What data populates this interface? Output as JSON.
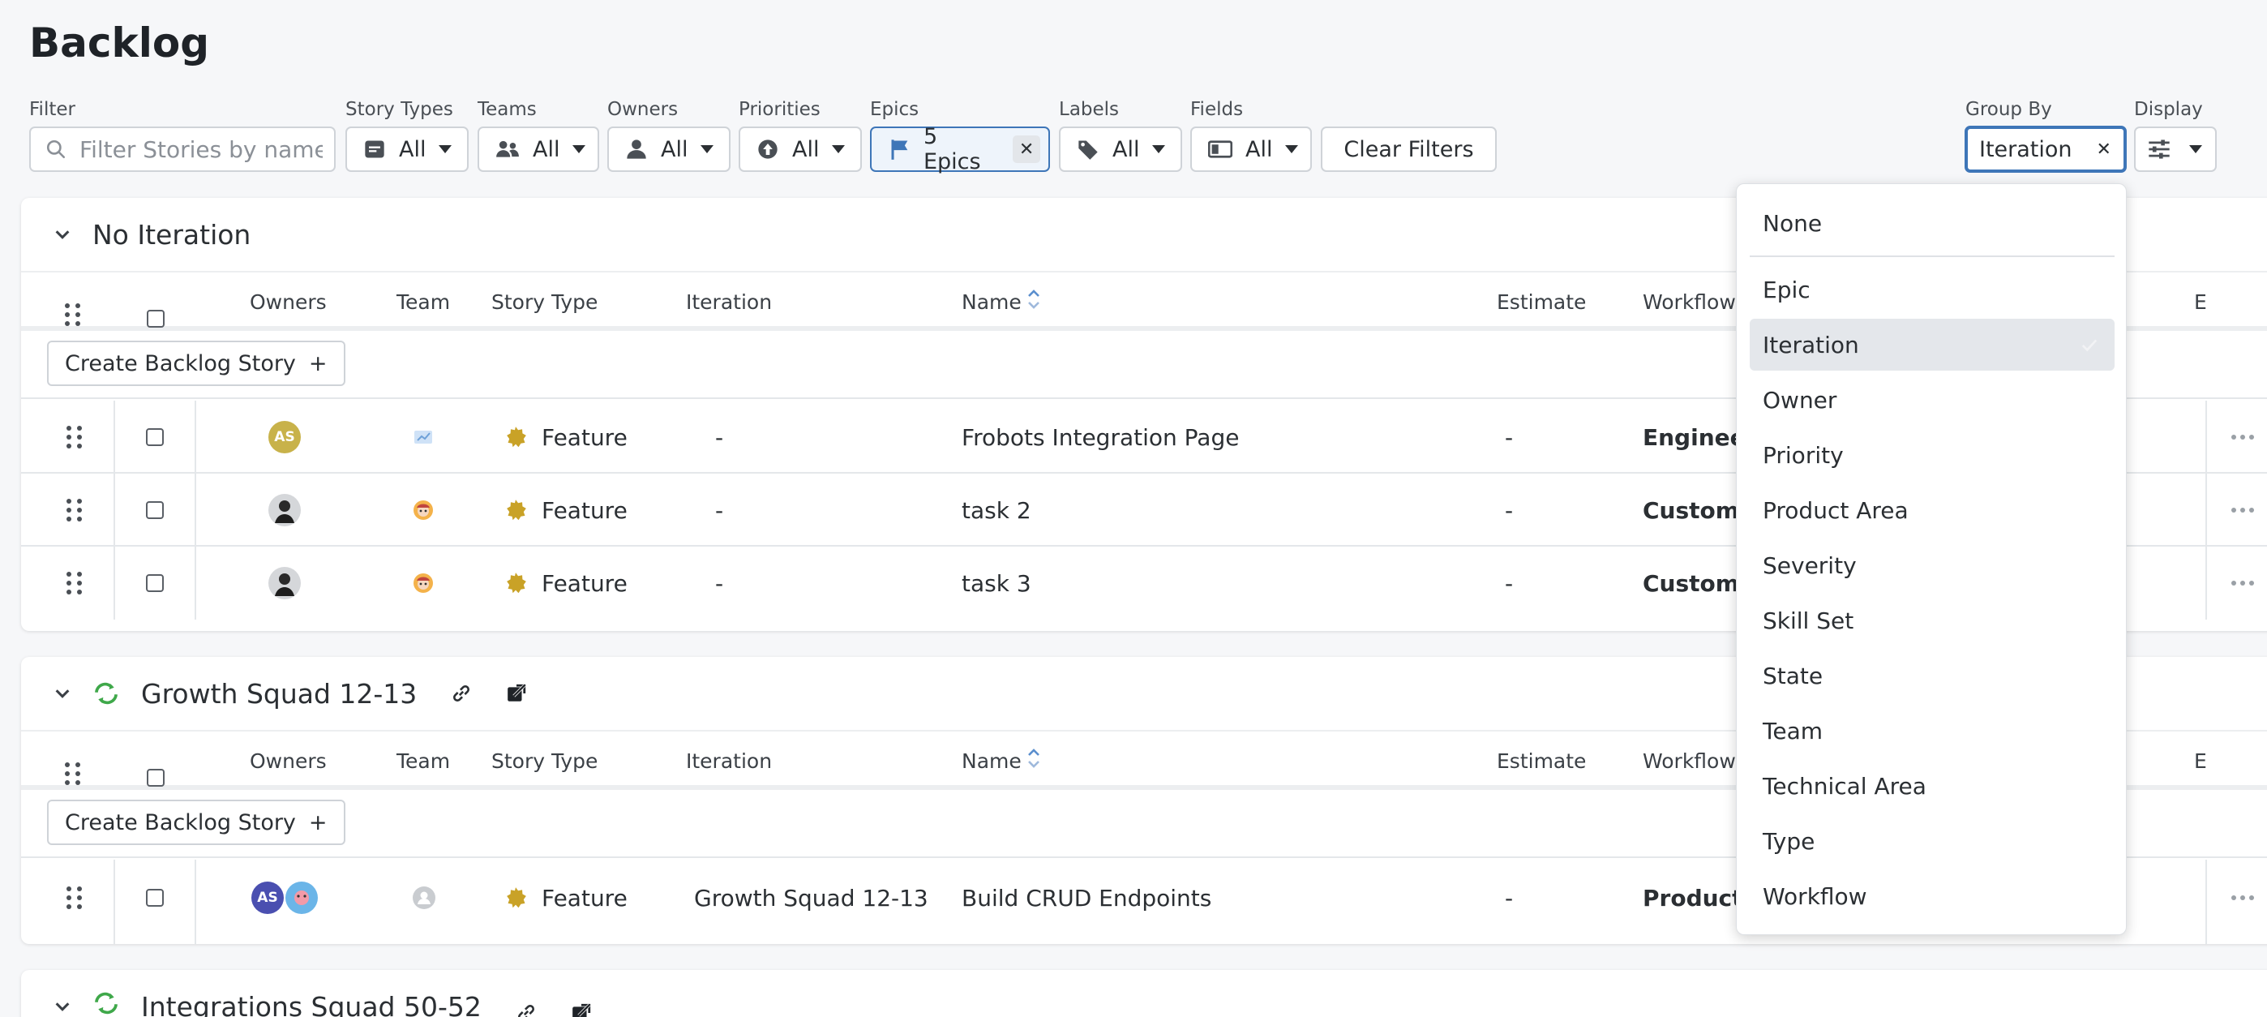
{
  "page_title": "Backlog",
  "filters": {
    "filter_label": "Filter",
    "search_placeholder": "Filter Stories by name",
    "story_types": {
      "label": "Story Types",
      "value": "All"
    },
    "teams": {
      "label": "Teams",
      "value": "All"
    },
    "owners": {
      "label": "Owners",
      "value": "All"
    },
    "priorities": {
      "label": "Priorities",
      "value": "All"
    },
    "epics": {
      "label": "Epics",
      "value": "5 Epics"
    },
    "labels": {
      "label": "Labels",
      "value": "All"
    },
    "fields": {
      "label": "Fields",
      "value": "All"
    },
    "clear_label": "Clear Filters",
    "group_by": {
      "label": "Group By",
      "value": "Iteration"
    },
    "display": {
      "label": "Display"
    }
  },
  "columns": {
    "owners": "Owners",
    "team": "Team",
    "story_type": "Story Type",
    "iteration": "Iteration",
    "name": "Name",
    "estimate": "Estimate",
    "workflow": "Workflow",
    "epic_short": "E"
  },
  "create_label": "Create Backlog Story",
  "groups": [
    {
      "title": "No Iteration",
      "rows": [
        {
          "owner_initials": "AS",
          "story_type": "Feature",
          "iteration": "-",
          "name": "Frobots Integration Page",
          "estimate": "-",
          "workflow": "Engineeri"
        },
        {
          "story_type": "Feature",
          "iteration": "-",
          "name": "task 2",
          "estimate": "-",
          "workflow": "Customer"
        },
        {
          "story_type": "Feature",
          "iteration": "-",
          "name": "task 3",
          "estimate": "-",
          "workflow": "Customer"
        }
      ]
    },
    {
      "title": "Growth Squad 12-13",
      "rows": [
        {
          "owner_initials": "AS",
          "story_type": "Feature",
          "iteration": "Growth Squad 12-13",
          "name": "Build CRUD Endpoints",
          "estimate": "-",
          "workflow": "Product"
        }
      ]
    },
    {
      "title": "Integrations Squad 50-52"
    }
  ],
  "group_by_menu": {
    "selected": "Iteration",
    "items": [
      "None",
      "Epic",
      "Iteration",
      "Owner",
      "Priority",
      "Product Area",
      "Severity",
      "Skill Set",
      "State",
      "Team",
      "Technical Area",
      "Type",
      "Workflow"
    ]
  },
  "colors": {
    "accent": "#3e76b8",
    "feature_icon": "#c9a227",
    "iteration_icon": "#3fa84a",
    "avatar_gold": "#c8b24a",
    "avatar_indigo": "#4a4fb0"
  }
}
